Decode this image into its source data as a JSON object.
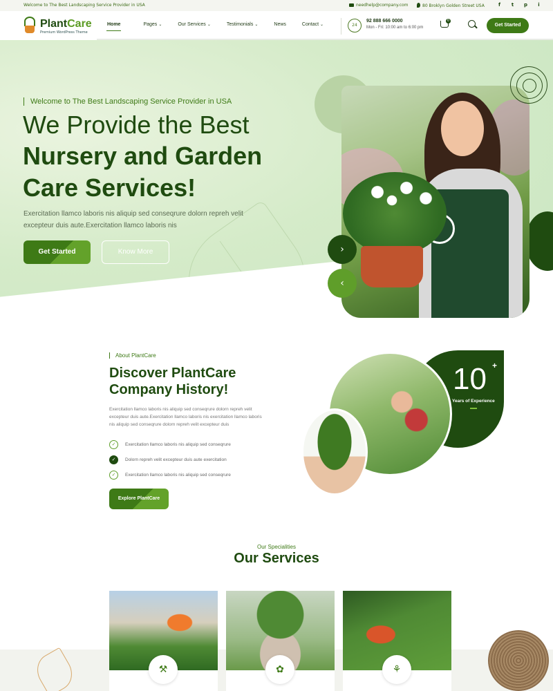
{
  "topbar": {
    "welcome": "Welcome to The Best Landscaping Service Provider in USA",
    "email": "needhelp@company.com",
    "address": "80 Broklyn Golden Street USA",
    "social": [
      "f",
      "t",
      "p",
      "i"
    ]
  },
  "header": {
    "logo_name_a": "Plant",
    "logo_name_b": "Care",
    "logo_tagline": "Premium WordPress Theme",
    "nav": [
      {
        "label": "Home",
        "caret": ""
      },
      {
        "label": "Pages",
        "caret": "⌄"
      },
      {
        "label": "Our Services",
        "caret": "⌄"
      },
      {
        "label": "Testimonials",
        "caret": "⌄"
      },
      {
        "label": "News",
        "caret": ""
      },
      {
        "label": "Contact",
        "caret": "⌄"
      }
    ],
    "phone": "92 888 666 0000",
    "hours": "Mon - Fri: 10:00 am to 6:00 pm",
    "cart_count": "0",
    "cta": "Get Started"
  },
  "hero": {
    "subtitle": "Welcome to The Best Landscaping Service Provider in USA",
    "title_line1": "We Provide the Best",
    "title_line2": "Nursery and Garden",
    "title_line3": "Care Services!",
    "description": "Exercitation llamco laboris nis aliquip sed conseqrure dolorn repreh velit excepteur duis aute.Exercitation llamco laboris nis",
    "btn_primary": "Get Started",
    "btn_secondary": "Know More",
    "next_arrow": "›",
    "prev_arrow": "‹"
  },
  "about": {
    "subtitle": "About PlantCare",
    "title_line1": "Discover PlantCare",
    "title_line2": "Company History!",
    "description": "Exercitation llamco laboris nis aliquip sed conseqrure dolorn repreh velit excepteur duis aute.Exercitation llamco laboris nis exercitation llamco laboris nis aliquip sed conseqrure dolorn repreh velit excepteur duis",
    "checklist": [
      "Exercitation llamco laboris nis aliquip sed conseqrure",
      "Dolorn repreh velit excepteur duis aute exercitation",
      "Exercitation llamco laboris nis aliquip sed conseqrure"
    ],
    "cta": "Explore PlantCare",
    "years_number": "10",
    "years_plus": "+",
    "years_label": "Years of Experience"
  },
  "services": {
    "subtitle": "Our Specialities",
    "title": "Our Services",
    "cards": [
      {
        "icon": "garden-tools-icon"
      },
      {
        "icon": "plant-care-icon"
      },
      {
        "icon": "lawn-mower-icon"
      }
    ]
  },
  "colors": {
    "brand_dark": "#1f4b10",
    "brand": "#3e7a16",
    "brand_light": "#5f9e2a"
  }
}
